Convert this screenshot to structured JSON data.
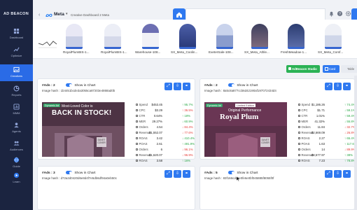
{
  "brand": {
    "name": "AD BEACON"
  },
  "sidebar": {
    "items": [
      {
        "label": "Dashboard",
        "icon": "grid-icon"
      },
      {
        "label": "Optimize",
        "icon": "chart-line-icon"
      },
      {
        "label": "Creatives",
        "icon": "image-icon",
        "active": true
      },
      {
        "label": "Reports",
        "icon": "report-icon"
      },
      {
        "label": "MMM",
        "icon": "mmm-icon"
      },
      {
        "label": "Agents",
        "icon": "agents-icon"
      },
      {
        "label": "Audiences",
        "icon": "people-icon"
      },
      {
        "label": "Guide",
        "icon": "globe-icon"
      },
      {
        "label": "Learn",
        "icon": "play-icon"
      }
    ]
  },
  "header": {
    "platform": "Meta",
    "dashboard_title": "Creative Dashboard 2 Meta",
    "icons": [
      "back-arrow-icon",
      "home-icon",
      "bell-icon",
      "question-icon",
      "gear-icon"
    ]
  },
  "strip": {
    "items": [
      {
        "label": "RoyalPlumBIS-1..."
      },
      {
        "label": "RoyalPlumBIS-1..."
      },
      {
        "label": "Warehouse-108..."
      },
      {
        "label": "SX_Meta_Coolin..."
      },
      {
        "label": "ExeterSale-108..."
      },
      {
        "label": "SX_Meta_Athle..."
      },
      {
        "label": "FreshMeadow-1..."
      },
      {
        "label": "SX_Meta_Comf..."
      }
    ]
  },
  "toolbar": {
    "studio_label": "AdBeacon Studio",
    "card_label": "Card",
    "table_label": "Table"
  },
  "cards": [
    {
      "title": "#Ads : 2",
      "show_label": "Show in Chart",
      "hash": "Image hash : 1b4451bcde3a3055ca87203e4868ad0b",
      "creative": {
        "badge": "Dynamic Ad",
        "line1": "Most-Loved Color is",
        "line2": "BACK IN STOCK!",
        "tag": "DUVET COVER"
      },
      "metrics": [
        {
          "label": "Spend",
          "value": "$453.45",
          "delta": "↑ 95.7%",
          "dir": "up"
        },
        {
          "label": "CPC",
          "value": "$3.29",
          "delta": "↑ 36.5%",
          "dir": "down"
        },
        {
          "label": "CTR",
          "value": "0.64%",
          "delta": "↑ 18%",
          "dir": "up"
        },
        {
          "label": "MER",
          "value": "29.27%",
          "delta": "↓ 60.9%",
          "dir": "up"
        },
        {
          "label": "Orders",
          "value": "4.54",
          "delta": "↓ 84.4%",
          "dir": "down"
        },
        {
          "label": "Revenue",
          "value": "$1,552.07",
          "delta": "↓ 77.6%",
          "dir": "down"
        },
        {
          "label": "ROAS",
          "value": "3.42",
          "delta": "↓ 410.4%",
          "dir": "up"
        },
        {
          "label": "POAS",
          "value": "2.61",
          "delta": "↑ 491.9%",
          "dir": "up"
        },
        {
          "label": "Orders",
          "value": "6",
          "delta": "↓ 96.1%",
          "dir": "down"
        },
        {
          "label": "Revenue",
          "value": "$1,620.07",
          "delta": "↓ 96.9%",
          "dir": "down"
        },
        {
          "label": "ROAS",
          "value": "3.58",
          "delta": "↑ 16%",
          "dir": "up"
        }
      ]
    },
    {
      "title": "#Ads : 2",
      "show_label": "Show in Chart",
      "hash": "Image hash : 8a5c8a877ccb6d42190af197072434d4",
      "creative": {
        "badge": "Dynamic Ad",
        "line1": "Limited Edition",
        "line2a": "Original Performance",
        "line2": "Royal Plum",
        "tag": "DUVET COVER"
      },
      "metrics": [
        {
          "label": "Spend",
          "value": "$1,186.26",
          "delta": "↑ 74.4%",
          "dir": "up"
        },
        {
          "label": "CPC",
          "value": "$1.71",
          "delta": "↓ 59.1%",
          "dir": "up"
        },
        {
          "label": "CTR",
          "value": "1.01%",
          "delta": "↑ 59.4%",
          "dir": "up"
        },
        {
          "label": "MER",
          "value": "41.32%",
          "delta": "↓ 55.8%",
          "dir": "up"
        },
        {
          "label": "Orders",
          "value": "11.84",
          "delta": "↓ 32.7%",
          "dir": "down"
        },
        {
          "label": "Revenue",
          "value": "$2,669.09",
          "delta": "↓ 26.8%",
          "dir": "down"
        },
        {
          "label": "ROAS",
          "value": "2.27",
          "delta": "↑ 65.4%",
          "dir": "up"
        },
        {
          "label": "POAS",
          "value": "1.63",
          "delta": "↑ 117.6%",
          "dir": "up"
        },
        {
          "label": "Orders",
          "value": "14",
          "delta": "↓ 89.9%",
          "dir": "down"
        },
        {
          "label": "Revenue",
          "value": "$8,577.97",
          "delta": "↑ 38%",
          "dir": "up"
        },
        {
          "label": "ROAS",
          "value": "7.23",
          "delta": "↑ 78.8%",
          "dir": "up"
        }
      ]
    },
    {
      "title": "#Ads : 3",
      "show_label": "Show in Chart",
      "hash": "Image hash : d72a2d0420d6e8d4f7e5db6df94a0eb50c"
    },
    {
      "title": "#Ads : 5",
      "show_label": "Show in Chart",
      "hash": "Image hash : 83f166cdc0e0fe6e0bf045885f8055f0f"
    }
  ]
}
